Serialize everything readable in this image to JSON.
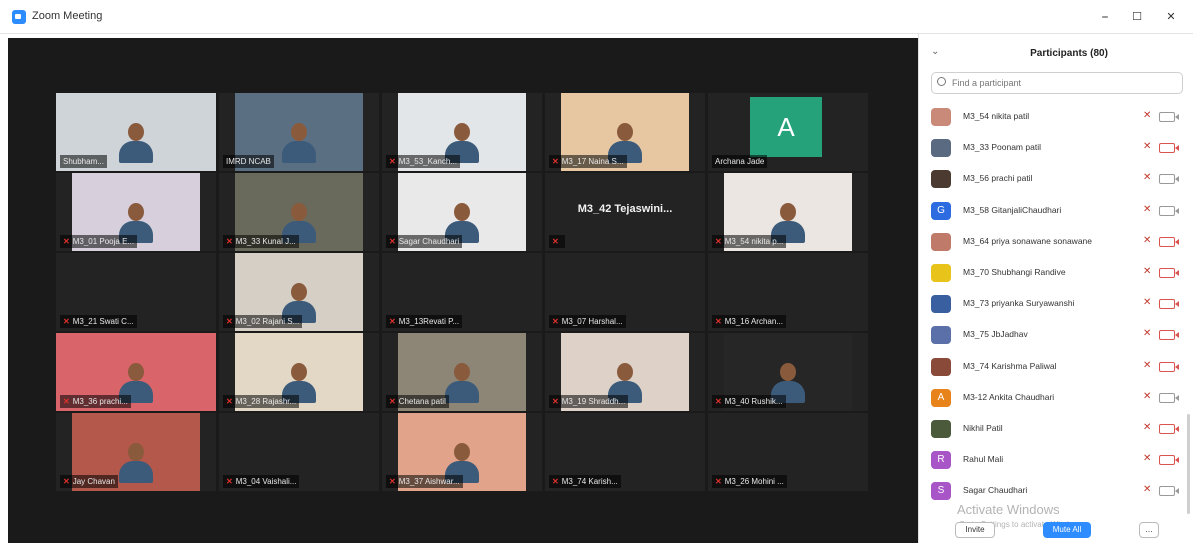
{
  "window": {
    "title": "Zoom Meeting",
    "minimize": "–",
    "maximize": "☐",
    "close": "✕"
  },
  "tiles": [
    {
      "name": "Shubham...",
      "muted": false,
      "bg": "#cfd4d8",
      "active": true
    },
    {
      "name": "IMRD NCAB",
      "muted": false,
      "bg": "#5b6f82"
    },
    {
      "name": "M3_53_Kanch...",
      "muted": true,
      "bg": "#e2e6e8"
    },
    {
      "name": "M3_17 Naina S...",
      "muted": true,
      "bg": "#e7c7a2"
    },
    {
      "name": "Archana Jade",
      "muted": false,
      "avatar": "A"
    },
    {
      "name": "M3_01 Pooja E...",
      "muted": true,
      "bg": "#d7d0dc"
    },
    {
      "name": "M3_33 Kunal J...",
      "muted": true,
      "bg": "#6a6a5c"
    },
    {
      "name": "Sagar Chaudhari",
      "muted": true,
      "bg": "#e9e9e9"
    },
    {
      "name": "",
      "muted": true,
      "big": "M3_42 Tejaswini..."
    },
    {
      "name": "M3_54 nikita p...",
      "muted": true,
      "bg": "#ebe6e2"
    },
    {
      "name": "M3_21 Swati C...",
      "muted": true
    },
    {
      "name": "M3_02 Rajani S...",
      "muted": true,
      "bg": "#d6cfc6"
    },
    {
      "name": "M3_13Revati P...",
      "muted": true
    },
    {
      "name": "M3_07 Harshal...",
      "muted": true
    },
    {
      "name": "M3_16 Archan...",
      "muted": true
    },
    {
      "name": "M3_36 prachi...",
      "muted": true,
      "bg": "#d9656a"
    },
    {
      "name": "M3_28 Rajashr...",
      "muted": true,
      "bg": "#e3d8c6"
    },
    {
      "name": "Chetana patil",
      "muted": true,
      "bg": "#8d8676"
    },
    {
      "name": "M3_19 Shraddh...",
      "muted": true,
      "bg": "#ddd1c8"
    },
    {
      "name": "M3_40 Rushik...",
      "muted": true,
      "bg": "#262626"
    },
    {
      "name": "Jay Chavan",
      "muted": true,
      "bg": "#b3584b"
    },
    {
      "name": "M3_04 Vaishali...",
      "muted": true
    },
    {
      "name": "M3_37 Aishwar...",
      "muted": true,
      "bg": "#e1a48a"
    },
    {
      "name": "M3_74 Karish...",
      "muted": true
    },
    {
      "name": "M3_26 Mohini ...",
      "muted": true
    }
  ],
  "panel": {
    "collapse": "⌄",
    "title": "Participants (80)",
    "search_placeholder": "Find a participant",
    "participants": [
      {
        "name": "M3_54 nikita patil",
        "avatar_color": "#c98a7a",
        "avatar_letter": "",
        "mic": "muted",
        "cam": "on"
      },
      {
        "name": "M3_33 Poonam patil",
        "avatar_color": "#5a6a80",
        "avatar_letter": "",
        "mic": "muted",
        "cam": "off"
      },
      {
        "name": "M3_56 prachi patil",
        "avatar_color": "#4a3a30",
        "avatar_letter": "",
        "mic": "muted",
        "cam": "on"
      },
      {
        "name": "M3_58 GitanjaliChaudhari",
        "avatar_color": "#2d6be0",
        "avatar_letter": "G",
        "mic": "muted",
        "cam": "on"
      },
      {
        "name": "M3_64 priya sonawane sonawane",
        "avatar_color": "#c07a6a",
        "avatar_letter": "",
        "mic": "muted",
        "cam": "off"
      },
      {
        "name": "M3_70 Shubhangi Randive",
        "avatar_color": "#e8c31a",
        "avatar_letter": "",
        "mic": "muted",
        "cam": "off"
      },
      {
        "name": "M3_73 priyanka Suryawanshi",
        "avatar_color": "#3a5fa0",
        "avatar_letter": "",
        "mic": "muted",
        "cam": "off"
      },
      {
        "name": "M3_75 JbJadhav",
        "avatar_color": "#5b6fa8",
        "avatar_letter": "",
        "mic": "muted",
        "cam": "off"
      },
      {
        "name": "M3_74 Karishma Paliwal",
        "avatar_color": "#8a4a3a",
        "avatar_letter": "",
        "mic": "muted",
        "cam": "off"
      },
      {
        "name": "M3-12 Ankita Chaudhari",
        "avatar_color": "#e8821a",
        "avatar_letter": "A",
        "mic": "muted",
        "cam": "on"
      },
      {
        "name": "Nikhil Patil",
        "avatar_color": "#4a5a3a",
        "avatar_letter": "",
        "mic": "muted",
        "cam": "off"
      },
      {
        "name": "Rahul Mali",
        "avatar_color": "#a855c8",
        "avatar_letter": "R",
        "mic": "muted",
        "cam": "off"
      },
      {
        "name": "Sagar Chaudhari",
        "avatar_color": "#a855c8",
        "avatar_letter": "S",
        "mic": "muted",
        "cam": "on"
      }
    ],
    "invite": "Invite",
    "mute_all": "Mute All",
    "more": "...",
    "watermark": "Activate Windows",
    "watermark_sub": "Go to Settings to activate Windows."
  },
  "colors": {
    "accent": "#2d8cff",
    "active_speaker": "#c8d400",
    "muted_red": "#e0312b",
    "video_bg": "#1a1a1a",
    "tile_bg": "#232323"
  }
}
